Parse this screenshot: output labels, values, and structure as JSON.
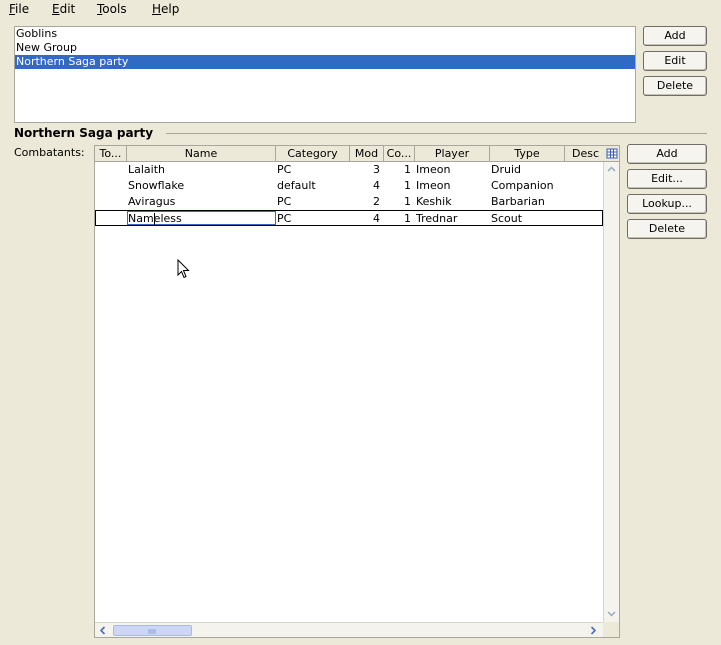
{
  "menu": [
    {
      "label": "File",
      "mnemonic": "F",
      "rest": "ile"
    },
    {
      "label": "Edit",
      "mnemonic": "E",
      "rest": "dit"
    },
    {
      "label": "Tools",
      "mnemonic": "T",
      "rest": "ools"
    },
    {
      "label": "Help",
      "mnemonic": "H",
      "rest": "elp"
    }
  ],
  "groups": {
    "items": [
      "Goblins",
      "New Group",
      "Northern Saga party"
    ],
    "selected": "Northern Saga party",
    "buttons": {
      "add": "Add",
      "edit": "Edit",
      "delete": "Delete"
    }
  },
  "section": {
    "title": "Northern Saga party",
    "combatants_label": "Combatants:"
  },
  "table": {
    "columns": [
      "To...",
      "Name",
      "Category",
      "Mod",
      "Co...",
      "Player",
      "Type",
      "Desc"
    ],
    "rows": [
      {
        "to": "",
        "name": "Lalaith",
        "category": "PC",
        "mod": "3",
        "count": "1",
        "player": "Imeon",
        "type": "Druid",
        "desc": ""
      },
      {
        "to": "",
        "name": "Snowflake",
        "category": "default",
        "mod": "4",
        "count": "1",
        "player": "Imeon",
        "type": "Companion",
        "desc": ""
      },
      {
        "to": "",
        "name": "Aviragus",
        "category": "PC",
        "mod": "2",
        "count": "1",
        "player": "Keshik",
        "type": "Barbarian",
        "desc": ""
      },
      {
        "to": "",
        "name": "Nameless",
        "category": "PC",
        "mod": "4",
        "count": "1",
        "player": "Trednar",
        "type": "Scout",
        "desc": ""
      }
    ],
    "editing_row": 3
  },
  "combatant_buttons": {
    "add": "Add",
    "edit": "Edit...",
    "lookup": "Lookup...",
    "delete": "Delete"
  },
  "icons": {
    "column_chooser": "grid-icon",
    "cursor": "mouse-pointer-icon"
  },
  "colors": {
    "selection": "#316ac5",
    "background": "#ece9d8"
  }
}
